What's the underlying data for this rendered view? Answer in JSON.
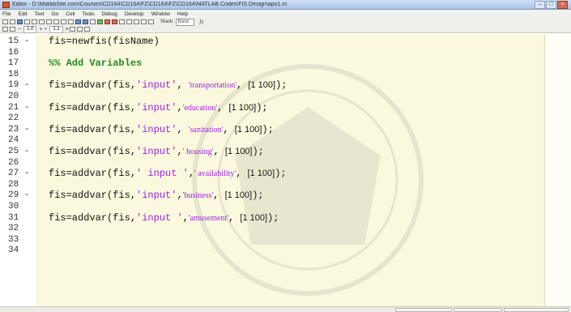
{
  "window": {
    "title": "Editor - D:\\MatlabSite.com\\Courses\\CD164\\CD164\\FZ\\CD164\\FZ\\CD164\\MATLAB Codes\\FIS Design\\apo1.m"
  },
  "menu": [
    "File",
    "Edit",
    "Text",
    "Go",
    "Cell",
    "Tools",
    "Debug",
    "Desktop",
    "Window",
    "Help"
  ],
  "toolbar": {
    "stack_label": "Stack:",
    "stack_value": "Base",
    "fx_label": "fx"
  },
  "cellbar": {
    "first_value": "1.0",
    "second_value": "1.1",
    "plus": "+",
    "minus": "−",
    "times": "×",
    "divide": "÷"
  },
  "editor": {
    "lines": [
      {
        "n": "15",
        "dash": true,
        "code": "fis=newfis(fisName)"
      },
      {
        "n": "16",
        "dash": false,
        "code": ""
      },
      {
        "n": "17",
        "dash": false,
        "comment": "%% Add Variables"
      },
      {
        "n": "18",
        "dash": false,
        "code": ""
      },
      {
        "n": "19",
        "dash": true,
        "pre": "fis=addvar(fis,",
        "s1": "'input'",
        "mid": ", ",
        "s2": "'transportation'",
        "post": ", ",
        "vec": "[1 100]",
        "end": ");"
      },
      {
        "n": "20",
        "dash": false,
        "code": ""
      },
      {
        "n": "21",
        "dash": true,
        "pre": "fis=addvar(fis,",
        "s1": "'input'",
        "mid": ",",
        "s2": "'education'",
        "post": ", ",
        "vec": "[1 100]",
        "end": ");"
      },
      {
        "n": "22",
        "dash": false,
        "code": ""
      },
      {
        "n": "23",
        "dash": true,
        "pre": "fis=addvar(fis,",
        "s1": "'input'",
        "mid": ", ",
        "s2": "'sanitation'",
        "post": ", ",
        "vec": "[1 100]",
        "end": ");"
      },
      {
        "n": "24",
        "dash": false,
        "code": ""
      },
      {
        "n": "25",
        "dash": true,
        "pre": "fis=addvar(fis,",
        "s1": "'input'",
        "mid": ",",
        "s2": "' housing'",
        "post": ", ",
        "vec": "[1 100]",
        "end": ");"
      },
      {
        "n": "26",
        "dash": false,
        "code": ""
      },
      {
        "n": "27",
        "dash": true,
        "pre": "fis=addvar(fis,",
        "s1": "' input '",
        "mid": ",",
        "s2": "' availability'",
        "post": ", ",
        "vec": "[1 100]",
        "end": ");"
      },
      {
        "n": "28",
        "dash": false,
        "code": ""
      },
      {
        "n": "29",
        "dash": true,
        "pre": "fis=addvar(fis,",
        "s1": "'input'",
        "mid": ",",
        "s2": "'business'",
        "post": ", ",
        "vec": "[1 100]",
        "end": ");"
      },
      {
        "n": "30",
        "dash": false,
        "code": ""
      },
      {
        "n": "31",
        "dash": false,
        "pre": "fis=addvar(fis,",
        "s1": "'input '",
        "mid": ",",
        "s2": "'amusement'",
        "post": ", ",
        "vec": "[1 100]",
        "end": ");"
      },
      {
        "n": "32",
        "dash": false,
        "code": ""
      },
      {
        "n": "33",
        "dash": false,
        "code": ""
      },
      {
        "n": "34",
        "dash": false,
        "code": ""
      }
    ]
  }
}
